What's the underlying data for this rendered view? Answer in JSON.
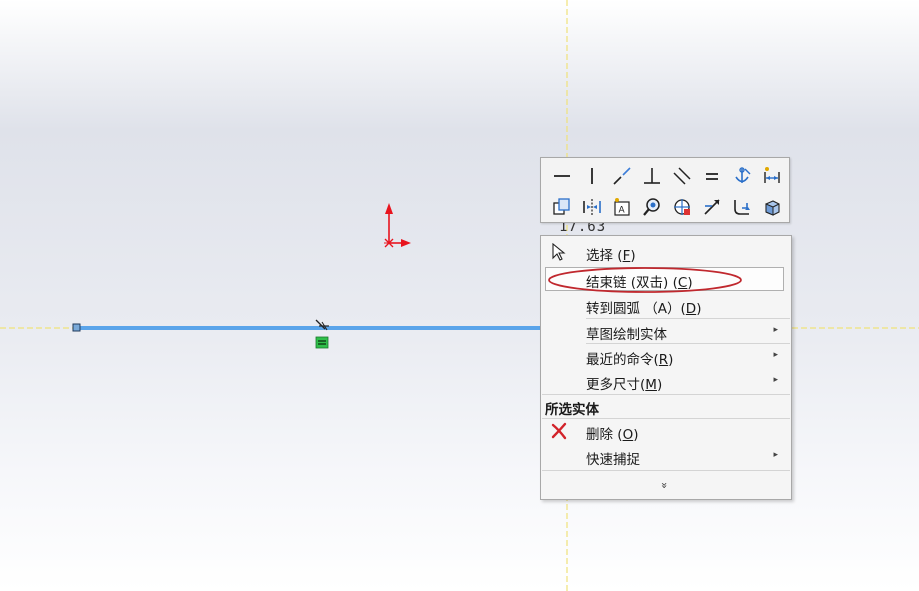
{
  "canvas": {
    "dimension_text": "17.63"
  },
  "toolbar": {
    "row1": [
      "horizontal-relation-icon",
      "vertical-relation-icon",
      "collinear-relation-icon",
      "perpendicular-relation-icon",
      "parallel-relation-icon",
      "equal-relation-icon",
      "fix-relation-icon",
      "smart-dimension-icon"
    ],
    "row2": [
      "copy-entities-icon",
      "mirror-entities-icon",
      "sketch-text-icon",
      "zoom-to-selection-icon",
      "display-relations-icon",
      "trim-entities-icon",
      "fillet-icon",
      "3d-sketch-icon"
    ]
  },
  "menu": {
    "items": [
      {
        "label_main": "选择 (",
        "mnemonic": "F",
        "label_end": ")"
      },
      {
        "label_main": "结束链 (双击) (",
        "mnemonic": "C",
        "label_end": ")"
      },
      {
        "label_main": "转到圆弧 （A）(",
        "mnemonic": "D",
        "label_end": ")"
      },
      {
        "label_main": "草图绘制实体",
        "mnemonic": "",
        "label_end": ""
      },
      {
        "label_main": "最近的命令(",
        "mnemonic": "R",
        "label_end": ")"
      },
      {
        "label_main": "更多尺寸(",
        "mnemonic": "M",
        "label_end": ")"
      },
      {
        "label_main": "删除 (",
        "mnemonic": "O",
        "label_end": ")"
      },
      {
        "label_main": "快速捕捉",
        "mnemonic": "",
        "label_end": ""
      }
    ],
    "section_title": "所选实体",
    "expand_glyph": "»",
    "submenu_arrow": "▸"
  },
  "colors": {
    "line_blue": "#5aa4ea",
    "axis_red": "#e8141e",
    "highlight_ellipse": "#c0282e",
    "guide_yellow": "#f0e27a",
    "relation_green": "#2fbf4a"
  }
}
